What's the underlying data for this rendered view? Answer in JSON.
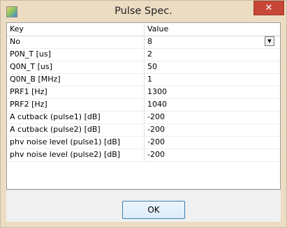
{
  "window": {
    "title": "Pulse Spec.",
    "close_glyph": "✕",
    "app_icon": "app-icon"
  },
  "table": {
    "headers": {
      "key": "Key",
      "value": "Value"
    },
    "rows": [
      {
        "key": "No",
        "value": "8"
      },
      {
        "key": "P0N_T [us]",
        "value": "2"
      },
      {
        "key": "Q0N_T [us]",
        "value": "50"
      },
      {
        "key": "Q0N_B [MHz]",
        "value": "1"
      },
      {
        "key": "PRF1 [Hz]",
        "value": "1300"
      },
      {
        "key": "PRF2 [Hz]",
        "value": "1040"
      },
      {
        "key": "A cutback (pulse1) [dB]",
        "value": "-200"
      },
      {
        "key": "A cutback (pulse2) [dB]",
        "value": "-200"
      },
      {
        "key": "phv noise level (pulse1) [dB]",
        "value": "-200"
      },
      {
        "key": "phv noise level (pulse2) [dB]",
        "value": "-200"
      }
    ],
    "dropdown_glyph": "▼"
  },
  "buttons": {
    "ok_label": "OK"
  },
  "colors": {
    "frame": "#ecdcc2",
    "close": "#c74737",
    "ok_border": "#3c7fb1"
  }
}
